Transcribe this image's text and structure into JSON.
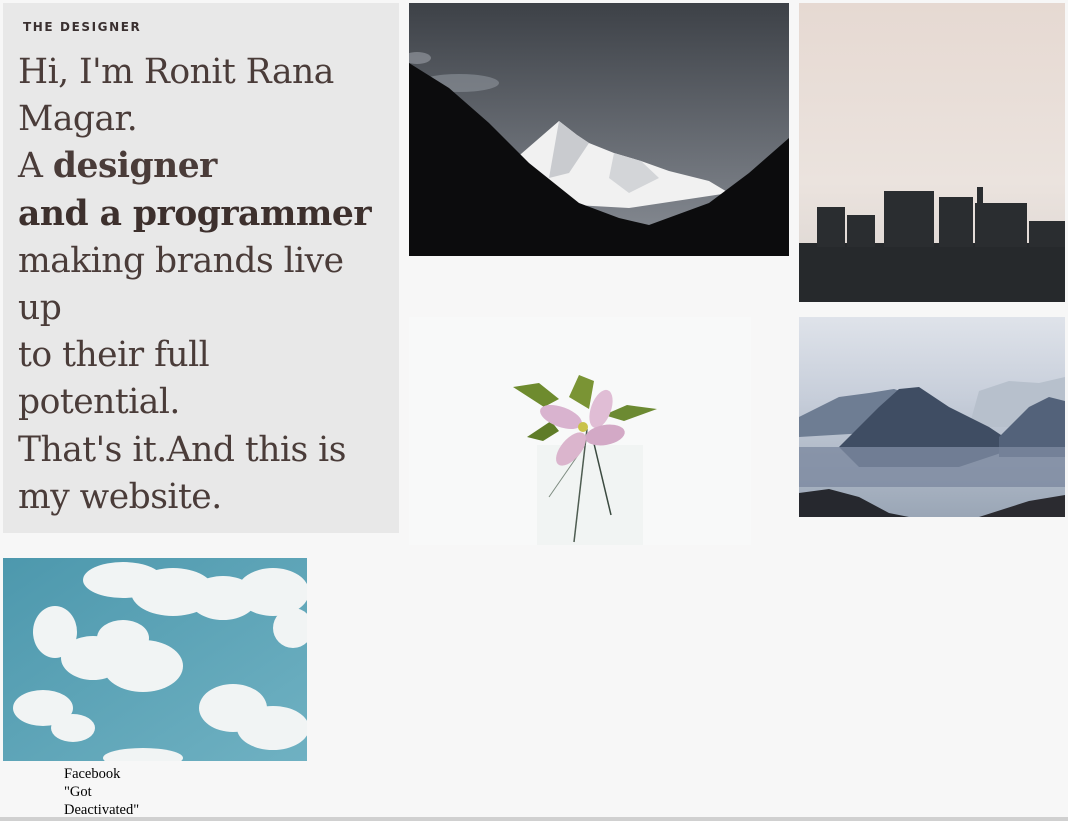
{
  "intro": {
    "kicker": "THE DESIGNER",
    "lines": [
      "Hi, I'm Ronit Rana",
      "Magar.",
      "A designer",
      "and a programmer",
      "making brands live",
      "up",
      "to their full",
      "potential.",
      "That's it.And this is",
      "my website."
    ]
  },
  "caption": {
    "lines": [
      "Facebook",
      "\"Got",
      "Deactivated\""
    ]
  },
  "images": {
    "mountain_peak": "snowy mountain peak photo",
    "city_skyline": "city skyline at dusk photo",
    "flower": "pink flower in glass photo",
    "misty_mountains": "misty mountain range photo",
    "clouds": "clouds in blue sky photo"
  }
}
